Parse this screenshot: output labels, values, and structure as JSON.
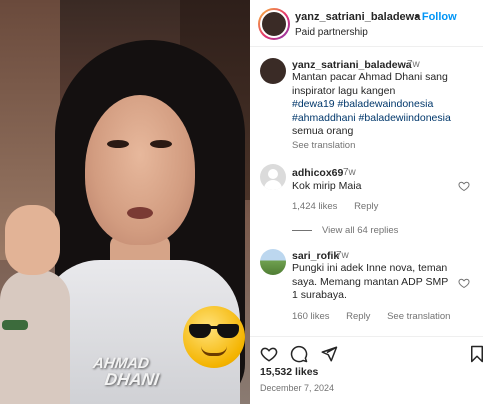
{
  "media": {
    "watermark_line1": "AHMAD",
    "watermark_line2": "DHANI"
  },
  "header": {
    "username": "yanz_satriani_baladewa",
    "separator": "•",
    "follow_label": "Follow",
    "subtitle": "Paid partnership"
  },
  "caption": {
    "username": "yanz_satriani_baladewa",
    "time": "7w",
    "text_plain": "Mantan pacar Ahmad Dhani sang inspirator lagu kangen",
    "hashtags_line1": "#dewa19 #baladewaindonesia",
    "hashtags_line2": "#ahmaddhani #baladewiindonesia",
    "text_tail": "semua orang",
    "see_translation": "See translation"
  },
  "comments": [
    {
      "username": "adhicox69",
      "time": "7w",
      "text": "Kok mirip Maia",
      "likes": "1,424 likes",
      "reply": "Reply"
    },
    {
      "username": "sari_rofik",
      "time": "7w",
      "text": "Pungki ini adek Inne nova, teman saya. Memang mantan ADP SMP 1 surabaya.",
      "likes": "160 likes",
      "reply": "Reply",
      "see_translation": "See translation"
    }
  ],
  "view_all": "View all 64 replies",
  "actions": {
    "icons": [
      "heart-icon",
      "comment-icon",
      "share-icon",
      "bookmark-icon"
    ]
  },
  "footer": {
    "likes": "15,532 likes",
    "date": "December 7, 2024"
  },
  "colors": {
    "link_blue": "#0095f6",
    "hashtag": "#00376b",
    "muted": "#737373",
    "text": "#262626"
  }
}
